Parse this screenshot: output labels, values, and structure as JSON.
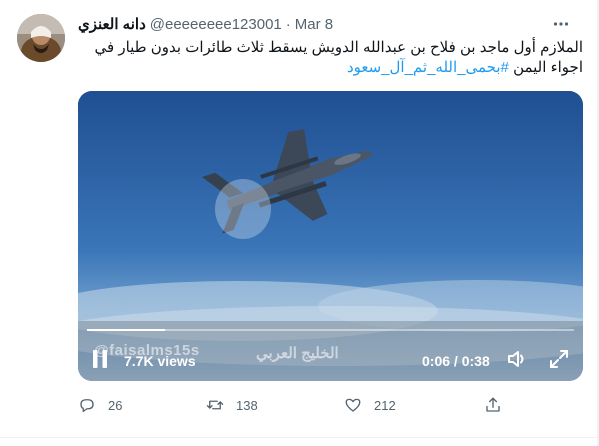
{
  "tweet": {
    "display_name": "دانه العنزي",
    "handle": "@eeeeeeee123001",
    "separator": "·",
    "time": "Mar 8",
    "text": "الملازم أول ماجد بن فلاح بن عبدالله الدويش يسقط ثلاث طائرات بدون طيار في اجواء اليمن",
    "hashtag": "#بحمى_الله_ثم_آل_سعود"
  },
  "video": {
    "views": "7.7K views",
    "elapsed": "0:06",
    "duration": "0:38",
    "timer_separator": " / ",
    "progress_fraction": 0.16,
    "watermark_handle": "@faisalms15s",
    "watermark_arabic": "الخليج العربي"
  },
  "actions": {
    "reply_count": "26",
    "retweet_count": "138",
    "like_count": "212"
  },
  "colors": {
    "accent": "#1d9bf0",
    "secondary_text": "#536471",
    "primary_text": "#0f1419"
  }
}
